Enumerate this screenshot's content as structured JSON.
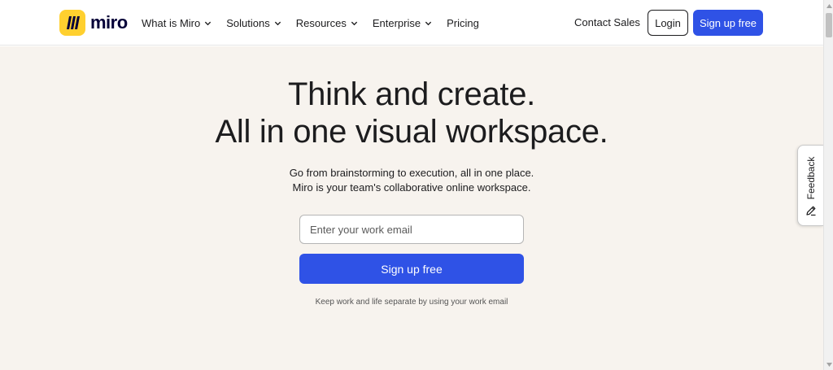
{
  "brand": {
    "name": "miro",
    "logo_color": "#ffd02f",
    "accent": "#2f52e6",
    "hero_bg": "#f7f3ee"
  },
  "nav": {
    "items": [
      {
        "label": "What is Miro",
        "has_dropdown": true
      },
      {
        "label": "Solutions",
        "has_dropdown": true
      },
      {
        "label": "Resources",
        "has_dropdown": true
      },
      {
        "label": "Enterprise",
        "has_dropdown": true
      },
      {
        "label": "Pricing",
        "has_dropdown": false
      }
    ],
    "contact_sales": "Contact Sales",
    "login": "Login",
    "signup": "Sign up free"
  },
  "hero": {
    "headline_line1": "Think and create.",
    "headline_line2": "All in one visual workspace.",
    "subtext_line1": "Go from brainstorming to execution, all in one place.",
    "subtext_line2": "Miro is your team's collaborative online workspace.",
    "email_placeholder": "Enter your work email",
    "email_value": "",
    "signup_button": "Sign up free",
    "hint": "Keep work and life separate by using your work email"
  },
  "feedback": {
    "label": "Feedback",
    "icon": "pencil-icon"
  }
}
